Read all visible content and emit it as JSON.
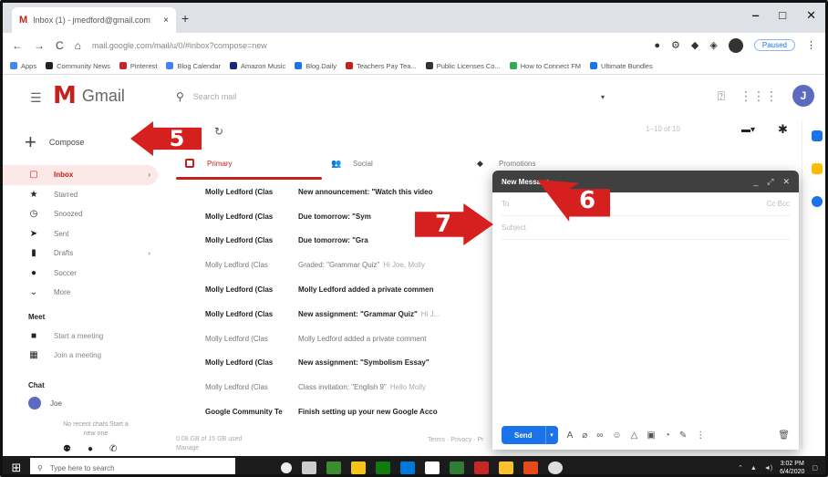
{
  "browser": {
    "tab_title": "Inbox (1) - jmedford@gmail.com",
    "tab_close": "×",
    "new_tab": "+",
    "url": "mail.google.com/mail/u/0/#inbox?compose=new",
    "win_min": "‒",
    "win_max": "□",
    "win_close": "✕",
    "paused_label": "Paused",
    "bookmarks": [
      {
        "label": "Apps",
        "color": "#4285f4"
      },
      {
        "label": "Community News",
        "color": "#222222"
      },
      {
        "label": "Pinterest",
        "color": "#c8232c"
      },
      {
        "label": "Blog Calendar",
        "color": "#4285f4"
      },
      {
        "label": "Amazon Music",
        "color": "#1a237e"
      },
      {
        "label": "Blog Daily",
        "color": "#1a73e8"
      },
      {
        "label": "Teachers Pay Tea...",
        "color": "#c5221f"
      },
      {
        "label": "Public Licenses Co...",
        "color": "#333333"
      },
      {
        "label": "How to Connect FM",
        "color": "#34a853"
      },
      {
        "label": "Ultimate Bundles",
        "color": "#1a73e8"
      }
    ]
  },
  "gmail": {
    "logo_m": "M",
    "logo_text": "Gmail",
    "search_placeholder": "Search mail",
    "account_initial": "J",
    "compose_label": "Compose",
    "nav": [
      {
        "icon": "▢",
        "label": "Inbox",
        "count": "",
        "active": true
      },
      {
        "icon": "★",
        "label": "Starred",
        "count": "",
        "active": false
      },
      {
        "icon": "◷",
        "label": "Snoozed",
        "count": "",
        "active": false
      },
      {
        "icon": "➤",
        "label": "Sent",
        "count": "",
        "active": false
      },
      {
        "icon": "▮",
        "label": "Drafts",
        "count": "",
        "active": false
      },
      {
        "icon": "●",
        "label": "Soccer",
        "count": "",
        "active": false
      },
      {
        "icon": "⌄",
        "label": "More",
        "count": "",
        "active": false
      }
    ],
    "meet_title": "Meet",
    "meet_items": [
      {
        "icon": "■",
        "label": "Start a meeting"
      },
      {
        "icon": "▦",
        "label": "Join a meeting"
      }
    ],
    "chat_title": "Chat",
    "chat_user": "Joe",
    "no_chats": "No recent chats Start a new one",
    "tabs": [
      {
        "label": "Primary",
        "selected": true
      },
      {
        "label": "Social",
        "selected": false
      },
      {
        "label": "Promotions",
        "selected": false
      }
    ],
    "paging": "1–10 of 10",
    "emails": [
      {
        "sender": "Molly Ledford (Clas",
        "subject": "New announcement: \"Watch this video",
        "snippet": "",
        "read": false
      },
      {
        "sender": "Molly Ledford (Clas",
        "subject": "Due tomorrow: \"Sym",
        "snippet": "",
        "read": false
      },
      {
        "sender": "Molly Ledford (Clas",
        "subject": "Due tomorrow: \"Gra",
        "snippet": "",
        "read": false
      },
      {
        "sender": "Molly Ledford (Clas",
        "subject": "Graded: \"Grammar Quiz\"",
        "snippet": "Hi Joe, Molly",
        "read": true
      },
      {
        "sender": "Molly Ledford (Clas",
        "subject": "Molly Ledford added a private commen",
        "snippet": "",
        "read": false
      },
      {
        "sender": "Molly Ledford (Clas",
        "subject": "New assignment: \"Grammar Quiz\"",
        "snippet": "Hi J...",
        "read": false
      },
      {
        "sender": "Molly Ledford (Clas",
        "subject": "Molly Ledford added a private comment",
        "snippet": "",
        "read": true
      },
      {
        "sender": "Molly Ledford (Clas",
        "subject": "New assignment: \"Symbolism Essay\"",
        "snippet": "",
        "read": false
      },
      {
        "sender": "Molly Ledford (Clas",
        "subject": "Class invitation: \"English 9\"",
        "snippet": "Hello Molly",
        "read": true
      },
      {
        "sender": "Google Community Te",
        "subject": "Finish setting up your new Google Acco",
        "snippet": "",
        "read": false
      }
    ],
    "storage": "0.08 GB of 15 GB used",
    "manage": "Manage",
    "footer_links": "Terms · Privacy · Pr"
  },
  "compose": {
    "title": "New Message",
    "to_placeholder": "To",
    "cc_bcc": "Cc Bcc",
    "subject_placeholder": "Subject",
    "send_label": "Send",
    "minimize": "_",
    "expand": "⤢",
    "close": "✕"
  },
  "callouts": {
    "step5": "5",
    "step6": "6",
    "step7": "7"
  },
  "taskbar": {
    "search_placeholder": "Type here to search",
    "time": "3:02 PM",
    "date": "6/4/2020"
  }
}
